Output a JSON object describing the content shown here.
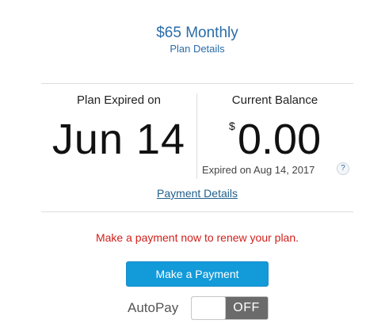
{
  "plan": {
    "name": "$65 Monthly",
    "details_link": "Plan Details"
  },
  "expiry": {
    "label": "Plan Expired on",
    "date": "Jun 14"
  },
  "balance": {
    "label": "Current Balance",
    "currency_symbol": "$",
    "amount": "0.00",
    "expired_note": "Expired on Aug 14, 2017",
    "help_glyph": "?"
  },
  "payment_details_link": "Payment Details",
  "warning_message": "Make a payment now to renew your plan.",
  "make_payment_button": "Make a Payment",
  "autopay": {
    "label": "AutoPay",
    "state": "OFF",
    "enabled": false
  },
  "colors": {
    "link_blue": "#2a6da8",
    "warning_red": "#d0201b",
    "button_blue": "#129ad9",
    "toggle_off_gray": "#6b6b6b"
  },
  "icons": {
    "help": "help-icon"
  }
}
